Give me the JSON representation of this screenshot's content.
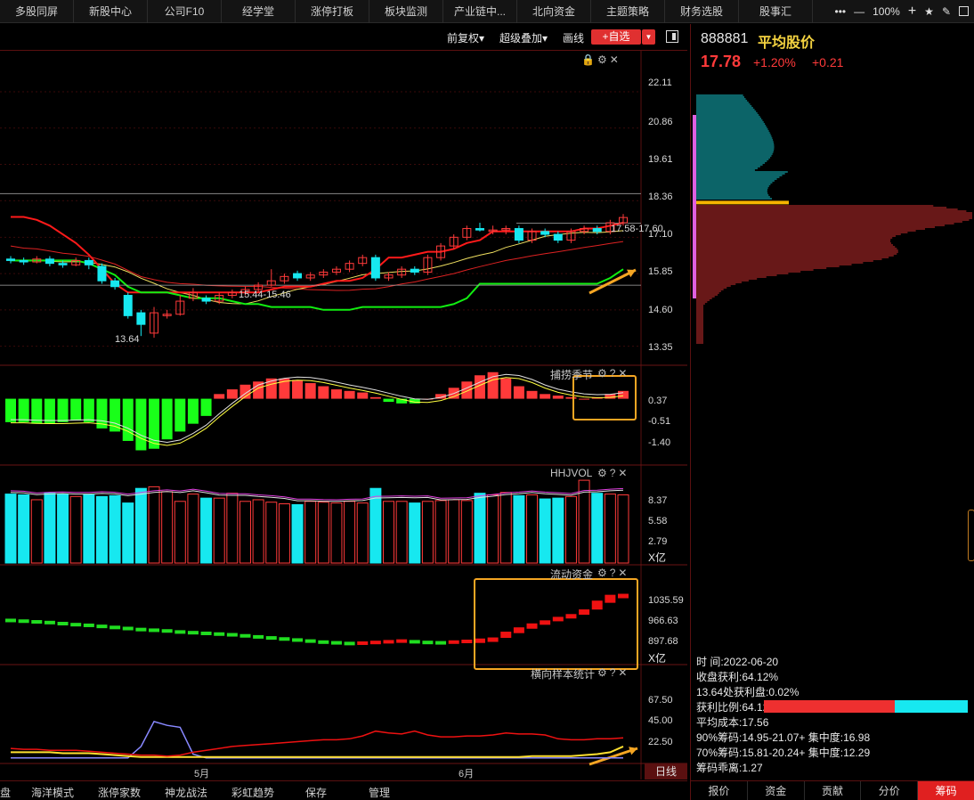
{
  "nav": {
    "tabs": [
      "多股同屏",
      "新股中心",
      "公司F10",
      "经学堂",
      "涨停打板",
      "板块监测",
      "产业链中...",
      "北向资金",
      "主题策略",
      "财务选股",
      "股事汇"
    ],
    "zoom": "100%",
    "icons": [
      "more-icon",
      "zoom-out-icon",
      "zoom-in-icon",
      "star-icon",
      "pen-icon",
      "maximize-icon"
    ]
  },
  "toolbar": {
    "adjust": "前复权▾",
    "overlay": "超级叠加▾",
    "draw": "画线",
    "add_watch": "+自选",
    "add_watch_arrow": "▼"
  },
  "colors": {
    "up": "#ff3a3a",
    "down": "#17e8f0",
    "macd_down": "#19ff19",
    "annotation": "#f5a623"
  },
  "chart_data": [
    {
      "type": "candlestick",
      "panel": "main",
      "y_ticks": [
        "22.11",
        "20.86",
        "19.61",
        "18.36",
        "17.10",
        "15.85",
        "14.60",
        "13.35"
      ],
      "ylim": [
        13.0,
        22.6
      ],
      "annotations": [
        "17.58-17.60",
        "15.44-15.46",
        "13.64"
      ],
      "x_ticks": [
        "5月",
        "6月"
      ],
      "candles": [
        {
          "o": 16.35,
          "c": 16.3,
          "h": 16.45,
          "l": 16.2
        },
        {
          "o": 16.3,
          "c": 16.25,
          "h": 16.4,
          "l": 16.15
        },
        {
          "o": 16.25,
          "c": 16.35,
          "h": 16.45,
          "l": 16.2
        },
        {
          "o": 16.35,
          "c": 16.2,
          "h": 16.45,
          "l": 16.1
        },
        {
          "o": 16.2,
          "c": 16.15,
          "h": 16.3,
          "l": 16.05
        },
        {
          "o": 16.15,
          "c": 16.3,
          "h": 16.4,
          "l": 16.1
        },
        {
          "o": 16.3,
          "c": 16.15,
          "h": 16.4,
          "l": 16.0
        },
        {
          "o": 16.1,
          "c": 15.6,
          "h": 16.2,
          "l": 15.5
        },
        {
          "o": 15.6,
          "c": 15.4,
          "h": 15.7,
          "l": 15.3
        },
        {
          "o": 15.1,
          "c": 14.4,
          "h": 15.2,
          "l": 14.3
        },
        {
          "o": 14.5,
          "c": 14.1,
          "h": 14.6,
          "l": 13.7
        },
        {
          "o": 13.8,
          "c": 14.5,
          "h": 14.7,
          "l": 13.64
        },
        {
          "o": 14.4,
          "c": 14.45,
          "h": 14.6,
          "l": 14.3
        },
        {
          "o": 14.45,
          "c": 14.9,
          "h": 15.1,
          "l": 14.4
        },
        {
          "o": 15.0,
          "c": 15.2,
          "h": 15.35,
          "l": 14.9
        },
        {
          "o": 15.0,
          "c": 14.9,
          "h": 15.1,
          "l": 14.8
        },
        {
          "o": 14.9,
          "c": 15.1,
          "h": 15.2,
          "l": 14.8
        },
        {
          "o": 15.1,
          "c": 15.2,
          "h": 15.3,
          "l": 15.0
        },
        {
          "o": 15.2,
          "c": 15.3,
          "h": 15.4,
          "l": 15.1
        },
        {
          "o": 15.3,
          "c": 15.45,
          "h": 15.55,
          "l": 15.2
        },
        {
          "o": 15.45,
          "c": 15.6,
          "h": 16.0,
          "l": 15.4
        },
        {
          "o": 15.6,
          "c": 15.75,
          "h": 15.85,
          "l": 15.5
        },
        {
          "o": 15.85,
          "c": 15.7,
          "h": 15.95,
          "l": 15.6
        },
        {
          "o": 15.7,
          "c": 15.8,
          "h": 15.9,
          "l": 15.6
        },
        {
          "o": 15.8,
          "c": 15.9,
          "h": 16.0,
          "l": 15.7
        },
        {
          "o": 15.9,
          "c": 16.0,
          "h": 16.1,
          "l": 15.8
        },
        {
          "o": 16.0,
          "c": 16.2,
          "h": 16.3,
          "l": 15.9
        },
        {
          "o": 16.2,
          "c": 16.4,
          "h": 16.5,
          "l": 16.1
        },
        {
          "o": 16.4,
          "c": 15.7,
          "h": 16.5,
          "l": 15.6
        },
        {
          "o": 15.7,
          "c": 15.8,
          "h": 15.9,
          "l": 15.6
        },
        {
          "o": 15.8,
          "c": 16.0,
          "h": 16.1,
          "l": 15.7
        },
        {
          "o": 16.0,
          "c": 15.9,
          "h": 16.1,
          "l": 15.8
        },
        {
          "o": 15.9,
          "c": 16.4,
          "h": 16.5,
          "l": 15.8
        },
        {
          "o": 16.4,
          "c": 16.8,
          "h": 16.9,
          "l": 16.3
        },
        {
          "o": 16.8,
          "c": 17.1,
          "h": 17.2,
          "l": 16.7
        },
        {
          "o": 17.1,
          "c": 17.4,
          "h": 17.5,
          "l": 17.0
        },
        {
          "o": 17.4,
          "c": 17.35,
          "h": 17.6,
          "l": 17.3
        },
        {
          "o": 17.3,
          "c": 17.35,
          "h": 17.5,
          "l": 17.2
        },
        {
          "o": 17.35,
          "c": 17.4,
          "h": 17.5,
          "l": 17.2
        },
        {
          "o": 17.4,
          "c": 17.0,
          "h": 17.5,
          "l": 16.9
        },
        {
          "o": 17.0,
          "c": 17.3,
          "h": 17.4,
          "l": 16.9
        },
        {
          "o": 17.3,
          "c": 17.2,
          "h": 17.4,
          "l": 17.1
        },
        {
          "o": 17.2,
          "c": 17.0,
          "h": 17.3,
          "l": 16.9
        },
        {
          "o": 17.0,
          "c": 17.3,
          "h": 17.4,
          "l": 16.9
        },
        {
          "o": 17.3,
          "c": 17.4,
          "h": 17.5,
          "l": 17.2
        },
        {
          "o": 17.4,
          "c": 17.3,
          "h": 17.5,
          "l": 17.2
        },
        {
          "o": 17.3,
          "c": 17.6,
          "h": 17.7,
          "l": 17.2
        },
        {
          "o": 17.6,
          "c": 17.78,
          "h": 17.9,
          "l": 17.5
        }
      ]
    },
    {
      "type": "bar",
      "panel": "macd",
      "title": "捕捞季节",
      "y_ticks": [
        "0.37",
        "-0.51",
        "-1.40"
      ],
      "ylim": [
        -1.9,
        0.95
      ]
    },
    {
      "type": "bar",
      "panel": "volume",
      "title": "HHJVOL",
      "y_ticks": [
        "8.37",
        "5.58",
        "2.79"
      ],
      "unit": "X亿",
      "ylim": [
        0,
        11.2
      ]
    },
    {
      "type": "bar",
      "panel": "flow",
      "title": "流动资金",
      "y_ticks": [
        "1035.59",
        "966.63",
        "897.68"
      ],
      "unit": "X亿",
      "ylim": [
        845,
        1100
      ]
    },
    {
      "type": "line",
      "panel": "stats",
      "title": "横向样本统计",
      "y_ticks": [
        "67.50",
        "45.00",
        "22.50"
      ],
      "ylim": [
        0,
        90
      ]
    }
  ],
  "period": "日线",
  "bottom_tabs": [
    "盘",
    "海洋模式",
    "涨停家数",
    "神龙战法",
    "彩虹趋势",
    "保存",
    "管理"
  ],
  "stock": {
    "code": "888881",
    "name": "平均股价",
    "price": "17.78",
    "pct": "+1.20%",
    "change": "+0.21"
  },
  "chip": {
    "time": "时      间:2022-06-20",
    "close_profit": "收盘获利:64.12%",
    "low_profit": "13.64处获利盘:0.02%",
    "ratio_label": "获利比例:64.12%",
    "ratio": 0.6412,
    "avg_cost": "平均成本:17.56",
    "c90": "90%筹码:14.95-21.07+ 集中度:16.98",
    "c70": "70%筹码:15.81-20.24+ 集中度:12.29",
    "deviation": "筹码乖离:1.27"
  },
  "right_tabs": [
    "报价",
    "资金",
    "贡献",
    "分价",
    "筹码"
  ]
}
